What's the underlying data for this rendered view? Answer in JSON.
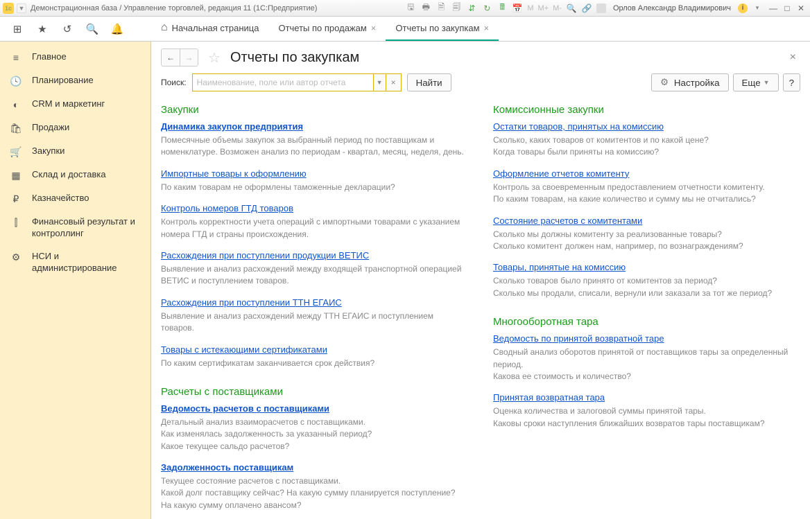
{
  "titlebar": {
    "title": "Демонстрационная база / Управление торговлей, редакция 11 (1С:Предприятие)",
    "user": "Орлов Александр Владимирович",
    "m1": "M",
    "m2": "M+",
    "m3": "M-"
  },
  "tabs": {
    "home": "Начальная страница",
    "t1": "Отчеты по продажам",
    "t2": "Отчеты по закупкам"
  },
  "sidebar": {
    "items": [
      {
        "label": "Главное",
        "icon": "≡"
      },
      {
        "label": "Планирование",
        "icon": "🕓"
      },
      {
        "label": "CRM и маркетинг",
        "icon": "◐"
      },
      {
        "label": "Продажи",
        "icon": "🛍"
      },
      {
        "label": "Закупки",
        "icon": "🛒"
      },
      {
        "label": "Склад и доставка",
        "icon": "▦"
      },
      {
        "label": "Казначейство",
        "icon": "₽"
      },
      {
        "label": "Финансовый результат и контроллинг",
        "icon": "⫿"
      },
      {
        "label": "НСИ и администрирование",
        "icon": "⚙"
      }
    ]
  },
  "page": {
    "title": "Отчеты по закупкам",
    "search_label": "Поиск:",
    "search_placeholder": "Наименование, поле или автор отчета",
    "find_btn": "Найти",
    "settings_btn": "Настройка",
    "more_btn": "Еще",
    "help_btn": "?"
  },
  "left_col": {
    "s1_title": "Закупки",
    "s1": [
      {
        "link": "Динамика закупок предприятия",
        "bold": true,
        "desc": "Помесячные объемы закупок за выбранный период по поставщикам и номенклатуре. Возможен анализ по периодам - квартал, месяц, неделя, день."
      },
      {
        "link": "Импортные товары к оформлению",
        "desc": "По каким товарам не оформлены таможенные декларации?"
      },
      {
        "link": "Контроль номеров ГТД товаров",
        "desc": "Контроль корректности учета операций с импортными товарами с указанием номера ГТД и страны происхождения."
      },
      {
        "link": "Расхождения при поступлении продукции ВЕТИС",
        "desc": "Выявление и анализ расхождений между входящей транспортной операцией ВЕТИС и поступлением товаров."
      },
      {
        "link": "Расхождения при поступлении ТТН ЕГАИС",
        "desc": "Выявление и анализ расхождений между ТТН ЕГАИС и поступлением товаров."
      },
      {
        "link": "Товары с истекающими сертификатами",
        "desc": "По каким сертификатам заканчивается срок действия?"
      }
    ],
    "s2_title": "Расчеты с поставщиками",
    "s2": [
      {
        "link": "Ведомость расчетов с поставщиками",
        "bold": true,
        "desc": "Детальный анализ взаиморасчетов с поставщиками.\nКак изменялась задолженность за указанный период?\nКакое текущее сальдо расчетов?"
      },
      {
        "link": "Задолженность поставщикам",
        "bold": true,
        "desc": "Текущее состояние расчетов с поставщиками.\nКакой долг поставщику сейчас? На какую сумму планируется поступление?\nНа какую сумму оплачено авансом?"
      }
    ]
  },
  "right_col": {
    "s1_title": "Комиссионные закупки",
    "s1": [
      {
        "link": "Остатки товаров, принятых на комиссию",
        "desc": "Сколько, каких товаров от комитентов и по какой цене?\nКогда товары были приняты на комиссию?"
      },
      {
        "link": "Оформление отчетов комитенту",
        "desc": "Контроль за своевременным предоставлением отчетности комитенту.\nПо каким товарам, на какие количество и сумму мы не отчитались?"
      },
      {
        "link": "Состояние расчетов с комитентами",
        "desc": "Сколько мы должны комитенту за реализованные товары?\nСколько комитент должен нам, например, по вознаграждениям?"
      },
      {
        "link": "Товары, принятые на комиссию",
        "desc": "Сколько товаров было принято от комитентов за период?\nСколько мы продали, списали, вернули или заказали за тот же период?"
      }
    ],
    "s2_title": "Многооборотная тара",
    "s2": [
      {
        "link": "Ведомость по принятой возвратной таре",
        "desc": "Сводный анализ оборотов принятой от поставщиков тары за определенный период.\nКакова ее стоимость и количество?"
      },
      {
        "link": "Принятая возвратная тара",
        "desc": "Оценка количества и залоговой суммы принятой тары.\nКаковы сроки наступления ближайших возвратов тары поставщикам?"
      }
    ]
  }
}
